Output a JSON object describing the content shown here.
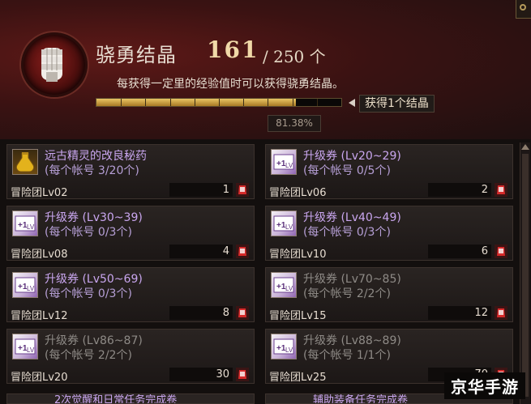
{
  "header": {
    "title": "骁勇结晶",
    "count": "161",
    "total": "/ 250 个",
    "description": "每获得一定里的经验值时可以获得骁勇结晶。",
    "progress": 0.8138,
    "reward_label": "获得1个结晶",
    "percent_text": "81.38%"
  },
  "cards": [
    {
      "name": "远古精灵的改良秘药",
      "sub": "(每个帐号 3/20个)",
      "level": "冒险团Lv02",
      "qty": "1",
      "icon": "potion-icon",
      "dim": false
    },
    {
      "name": "升级券 (Lv20~29)",
      "sub": "(每个帐号 0/5个)",
      "level": "冒险团Lv06",
      "qty": "2",
      "icon": "level-ticket-icon",
      "dim": false
    },
    {
      "name": "升级券 (Lv30~39)",
      "sub": "(每个帐号 0/3个)",
      "level": "冒险团Lv08",
      "qty": "4",
      "icon": "level-ticket-icon",
      "dim": false
    },
    {
      "name": "升级券 (Lv40~49)",
      "sub": "(每个帐号 0/3个)",
      "level": "冒险团Lv10",
      "qty": "6",
      "icon": "level-ticket-icon",
      "dim": false
    },
    {
      "name": "升级券 (Lv50~69)",
      "sub": "(每个帐号 0/3个)",
      "level": "冒险团Lv12",
      "qty": "8",
      "icon": "level-ticket-icon",
      "dim": false
    },
    {
      "name": "升级券 (Lv70~85)",
      "sub": "(每个帐号 2/2个)",
      "level": "冒险团Lv15",
      "qty": "12",
      "icon": "level-ticket-icon",
      "dim": true
    },
    {
      "name": "升级券 (Lv86~87)",
      "sub": "(每个帐号 2/2个)",
      "level": "冒险团Lv20",
      "qty": "30",
      "icon": "level-ticket-icon",
      "dim": true
    },
    {
      "name": "升级券 (Lv88~89)",
      "sub": "(每个帐号 1/1个)",
      "level": "冒险团Lv25",
      "qty": "70",
      "icon": "level-ticket-icon",
      "dim": true
    }
  ],
  "bottom_cards": [
    "2次觉醒和日常任务完成卷",
    "辅助装备任务完成卷"
  ],
  "watermark": "京华手游"
}
